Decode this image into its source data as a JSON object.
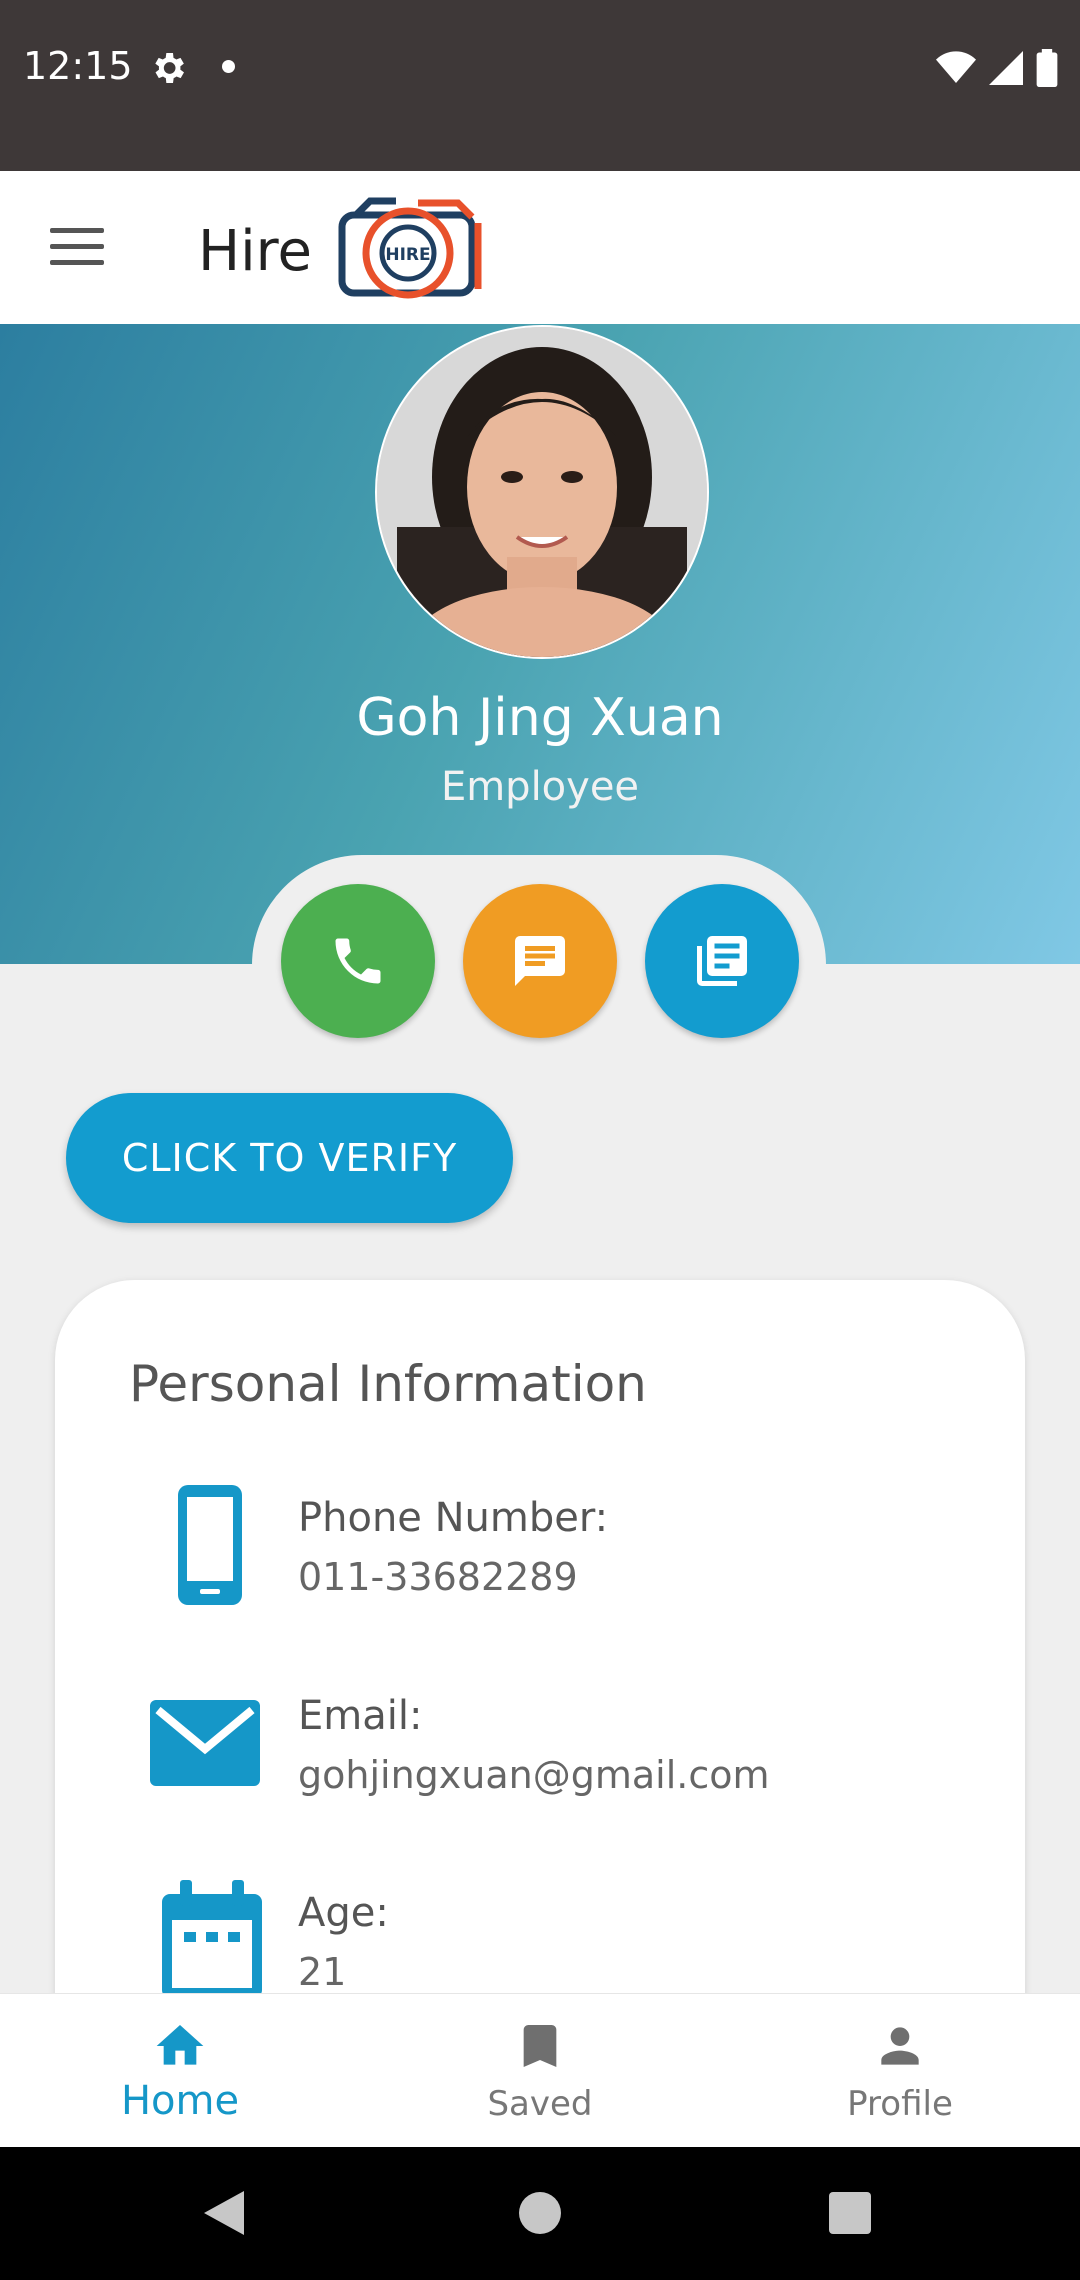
{
  "status_bar": {
    "time": "12:15"
  },
  "app_bar": {
    "brand": "Hire",
    "logo_text": "HIRE"
  },
  "profile": {
    "name": "Goh Jing Xuan",
    "role": "Employee"
  },
  "actions": {
    "call": {
      "color": "#4caf50",
      "icon": "phone-icon"
    },
    "message": {
      "color": "#f09c23",
      "icon": "message-icon"
    },
    "document": {
      "color": "#139ccf",
      "icon": "document-icon"
    }
  },
  "verify": {
    "label": "CLICK TO VERIFY"
  },
  "personal_info": {
    "title": "Personal Information",
    "fields": [
      {
        "label": "Phone Number:",
        "value": "011-33682289",
        "icon": "phone-device-icon"
      },
      {
        "label": "Email:",
        "value": "gohjingxuan@gmail.com",
        "icon": "email-icon"
      },
      {
        "label": "Age:",
        "value": "21",
        "icon": "calendar-icon"
      }
    ]
  },
  "bottom_nav": {
    "items": [
      {
        "label": "Home",
        "icon": "home-icon",
        "active": true
      },
      {
        "label": "Saved",
        "icon": "bookmark-icon",
        "active": false
      },
      {
        "label": "Profile",
        "icon": "person-icon",
        "active": false
      }
    ]
  },
  "colors": {
    "accent": "#139ccf",
    "call": "#4caf50",
    "message": "#f09c23",
    "status_bar": "#3e3838"
  }
}
